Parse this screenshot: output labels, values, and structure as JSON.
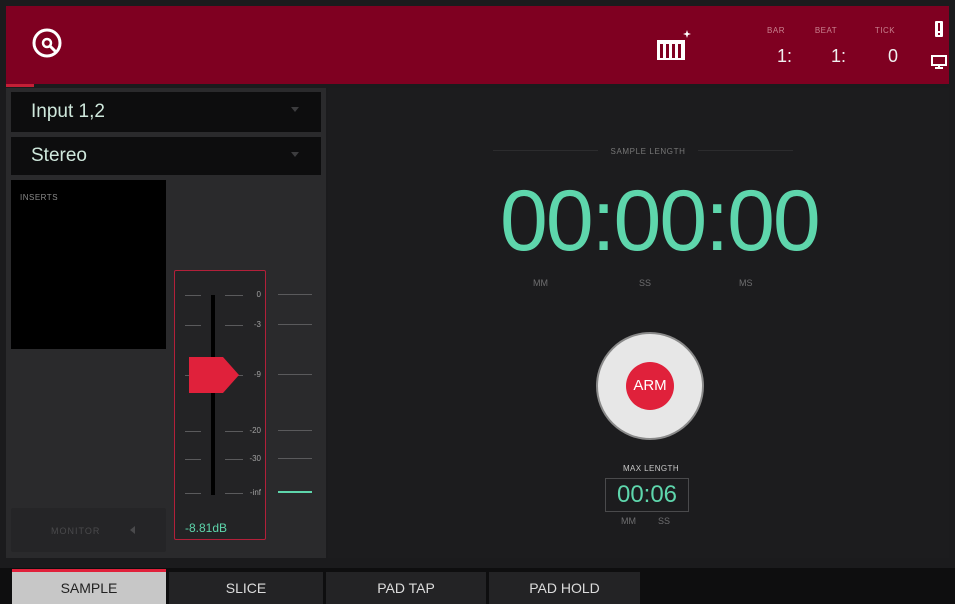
{
  "header": {
    "position": {
      "bar_label": "BAR",
      "beat_label": "BEAT",
      "tick_label": "TICK",
      "bar_value": "1:",
      "beat_value": "1:",
      "tick_value": "0"
    },
    "icons": [
      "record-disc-icon",
      "keyboard-sparkle-icon",
      "warning-icon",
      "monitor-icon"
    ]
  },
  "input": {
    "source": "Input 1,2",
    "mode": "Stereo"
  },
  "inserts": {
    "label": "INSERTS"
  },
  "monitor": {
    "label": "MONITOR"
  },
  "fader": {
    "scale": [
      "0",
      "-3",
      "-9",
      "-20",
      "-30",
      "-inf"
    ],
    "value_db": -8.81,
    "readout": "-8.81dB"
  },
  "sample": {
    "length_label": "SAMPLE LENGTH",
    "time": "00:00:00",
    "units": [
      "MM",
      "SS",
      "MS"
    ],
    "arm_label": "ARM",
    "max_length_label": "MAX LENGTH",
    "max_length": "00:06",
    "max_units": [
      "MM",
      "SS"
    ]
  },
  "tabs": [
    {
      "label": "SAMPLE",
      "active": true
    },
    {
      "label": "SLICE",
      "active": false
    },
    {
      "label": "PAD TAP",
      "active": false
    },
    {
      "label": "PAD HOLD",
      "active": false
    }
  ],
  "colors": {
    "header": "#7f0021",
    "accent": "#e0213b",
    "time_green": "#5ed6ac"
  }
}
